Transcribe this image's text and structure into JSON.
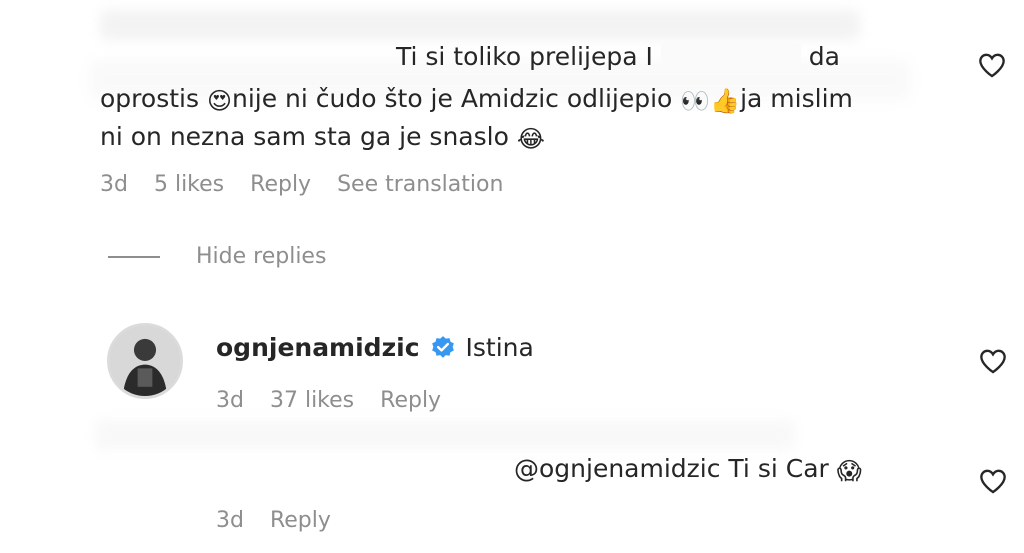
{
  "comment1": {
    "line1_part1": "Ti si toliko prelijepa I",
    "line1_part2": "da",
    "line2_part1": "oprostis",
    "emoji_heart_eyes": "😍",
    "line2_part2": "nije ni čudo što je Amidzic odlijepio",
    "emoji_eyes": "👀",
    "emoji_thumbs": "👍",
    "line2_part3": "ja mislim",
    "line3_part1": "ni on nezna sam sta ga je snaslo",
    "emoji_laugh": "😂",
    "meta": {
      "time": "3d",
      "likes": "5 likes",
      "reply": "Reply",
      "translate": "See translation"
    }
  },
  "hide_replies": {
    "label": "Hide replies"
  },
  "reply1": {
    "username": "ognjenamidzic",
    "text": "Istina",
    "meta": {
      "time": "3d",
      "likes": "37 likes",
      "reply": "Reply"
    }
  },
  "reply2": {
    "text": "@ognjenamidzic Ti si Car",
    "emoji_scream": "😱",
    "meta": {
      "time": "3d",
      "reply": "Reply"
    }
  },
  "icons": {
    "heart": "heart-icon",
    "verified": "verified-badge-icon",
    "avatar": "avatar"
  },
  "colors": {
    "text": "#262626",
    "secondary": "#8e8e8e",
    "verified_blue": "#3897f0"
  }
}
